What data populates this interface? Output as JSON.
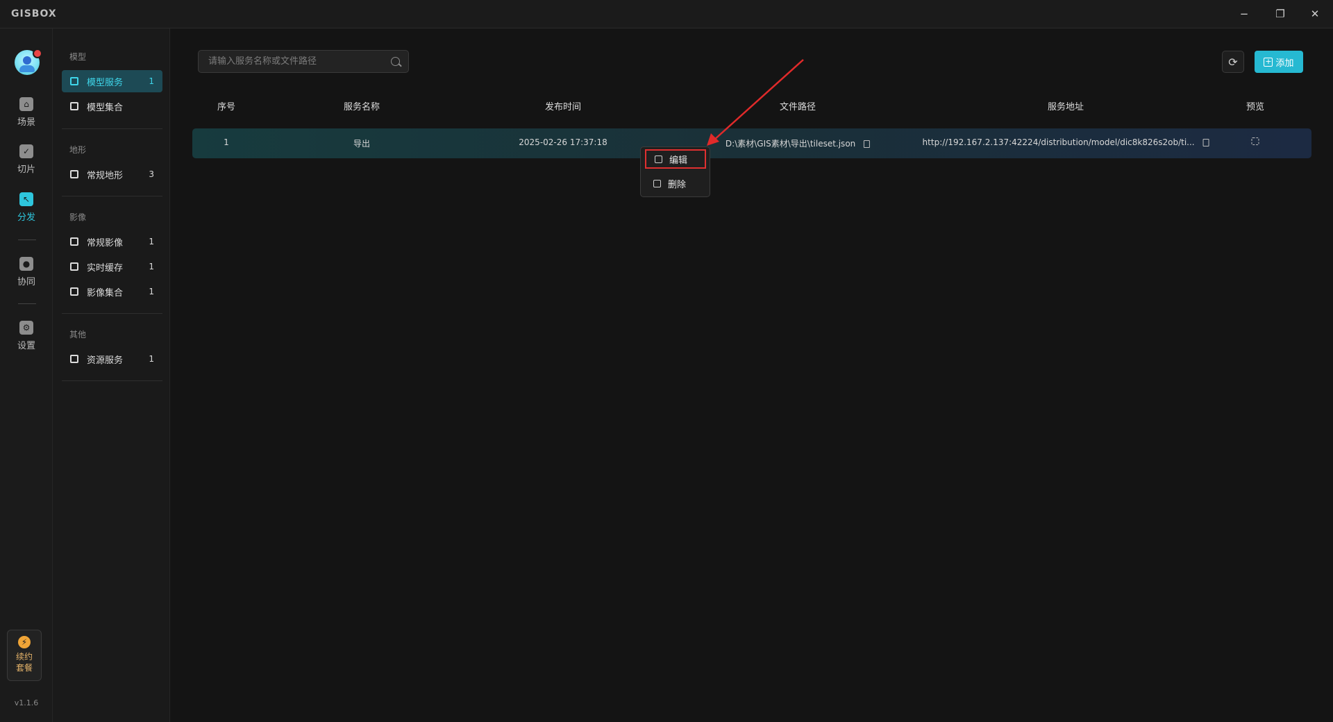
{
  "app": {
    "logo_text": "GISBOX"
  },
  "window_controls": {
    "minimize": "−",
    "maximize": "❐",
    "close": "✕"
  },
  "rail": {
    "items": [
      {
        "label": "场景",
        "icon": "home-icon"
      },
      {
        "label": "切片",
        "icon": "tile-icon"
      },
      {
        "label": "分发",
        "icon": "distribute-icon"
      },
      {
        "label": "协同",
        "icon": "lock-icon"
      },
      {
        "label": "设置",
        "icon": "gear-icon"
      }
    ],
    "promo_label_1": "续约",
    "promo_label_2": "套餐",
    "version": "v1.1.6"
  },
  "sidebar": {
    "groups": [
      {
        "title": "模型",
        "items": [
          {
            "label": "模型服务",
            "count": "1"
          },
          {
            "label": "模型集合",
            "count": ""
          }
        ]
      },
      {
        "title": "地形",
        "items": [
          {
            "label": "常规地形",
            "count": "3"
          }
        ]
      },
      {
        "title": "影像",
        "items": [
          {
            "label": "常规影像",
            "count": "1"
          },
          {
            "label": "实时缓存",
            "count": "1"
          },
          {
            "label": "影像集合",
            "count": "1"
          }
        ]
      },
      {
        "title": "其他",
        "items": [
          {
            "label": "资源服务",
            "count": "1"
          }
        ]
      }
    ]
  },
  "toolbar": {
    "search_placeholder": "请输入服务名称或文件路径",
    "add_label": "添加"
  },
  "table": {
    "columns": [
      "序号",
      "服务名称",
      "发布时间",
      "文件路径",
      "服务地址",
      "预览"
    ],
    "rows": [
      {
        "index": "1",
        "name": "导出",
        "time": "2025-02-26 17:37:18",
        "path": "D:\\素材\\GIS素材\\导出\\tileset.json",
        "url": "http://192.167.2.137:42224/distribution/model/dic8k826s2ob/ti..."
      }
    ]
  },
  "context_menu": {
    "items": [
      {
        "label": "编辑",
        "icon": "edit-icon"
      },
      {
        "label": "删除",
        "icon": "trash-icon"
      }
    ]
  },
  "colors": {
    "accent": "#26b9d2",
    "highlight_border": "#e03030",
    "background": "#141414"
  }
}
